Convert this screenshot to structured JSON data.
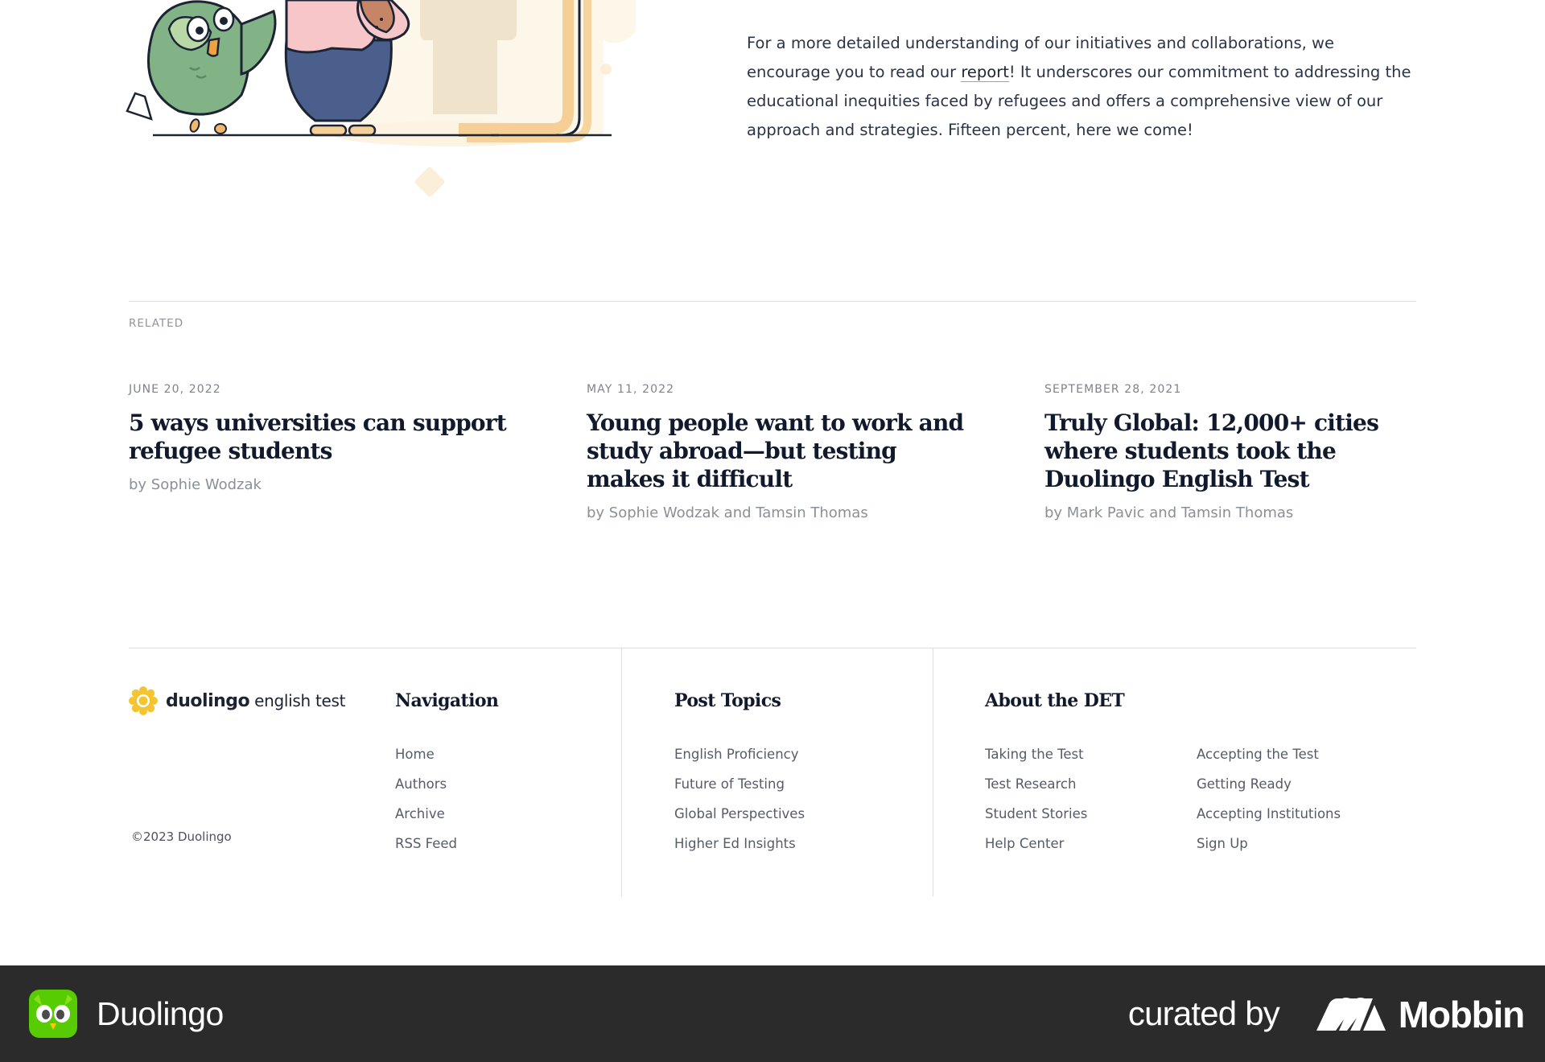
{
  "article": {
    "intro_prefix": "For a more detailed understanding of our initiatives and collaborations, we encourage you to read our ",
    "report_link": "report",
    "intro_suffix": "! It underscores our commitment to addressing the educational inequities faced by refugees and offers a comprehensive view of our approach and strategies. Fifteen percent, here we come!"
  },
  "related": {
    "label": "RELATED",
    "cards": [
      {
        "date": "JUNE 20, 2022",
        "title": "5 ways universities can support refugee students",
        "author": "by Sophie Wodzak"
      },
      {
        "date": "MAY 11, 2022",
        "title": "Young people want to work and study abroad—but testing makes it difficult",
        "author": "by Sophie Wodzak and Tamsin Thomas"
      },
      {
        "date": "SEPTEMBER 28, 2021",
        "title": "Truly Global: 12,000+ cities where students took the Duolingo English Test",
        "author": "by Mark Pavic and Tamsin Thomas"
      }
    ]
  },
  "footer": {
    "brand_bold": "duolingo",
    "brand_light": "english test",
    "copyright": "©2023 Duolingo",
    "navigation": {
      "heading": "Navigation",
      "links": [
        "Home",
        "Authors",
        "Archive",
        "RSS Feed"
      ]
    },
    "post_topics": {
      "heading": "Post Topics",
      "links": [
        "English Proficiency",
        "Future of Testing",
        "Global Perspectives",
        "Higher Ed Insights"
      ]
    },
    "about": {
      "heading": "About the DET",
      "links_left": [
        "Taking the Test",
        "Test Research",
        "Student Stories",
        "Help Center"
      ],
      "links_right": [
        "Accepting the Test",
        "Getting Ready",
        "Accepting Institutions",
        "Sign Up"
      ]
    }
  },
  "bottom_bar": {
    "app_name": "Duolingo",
    "curated_by": "curated by",
    "curator": "Mobbin"
  },
  "icons": {
    "app_icon": "duolingo-owl-icon",
    "brand_logo": "det-sun-logo",
    "curator_logo": "mobbin-logo"
  },
  "colors": {
    "heading": "#111a2c",
    "muted": "#8a9098",
    "bar": "#2b2b2b",
    "owl_green": "#58cc02",
    "logo_yellow": "#f5c431"
  }
}
